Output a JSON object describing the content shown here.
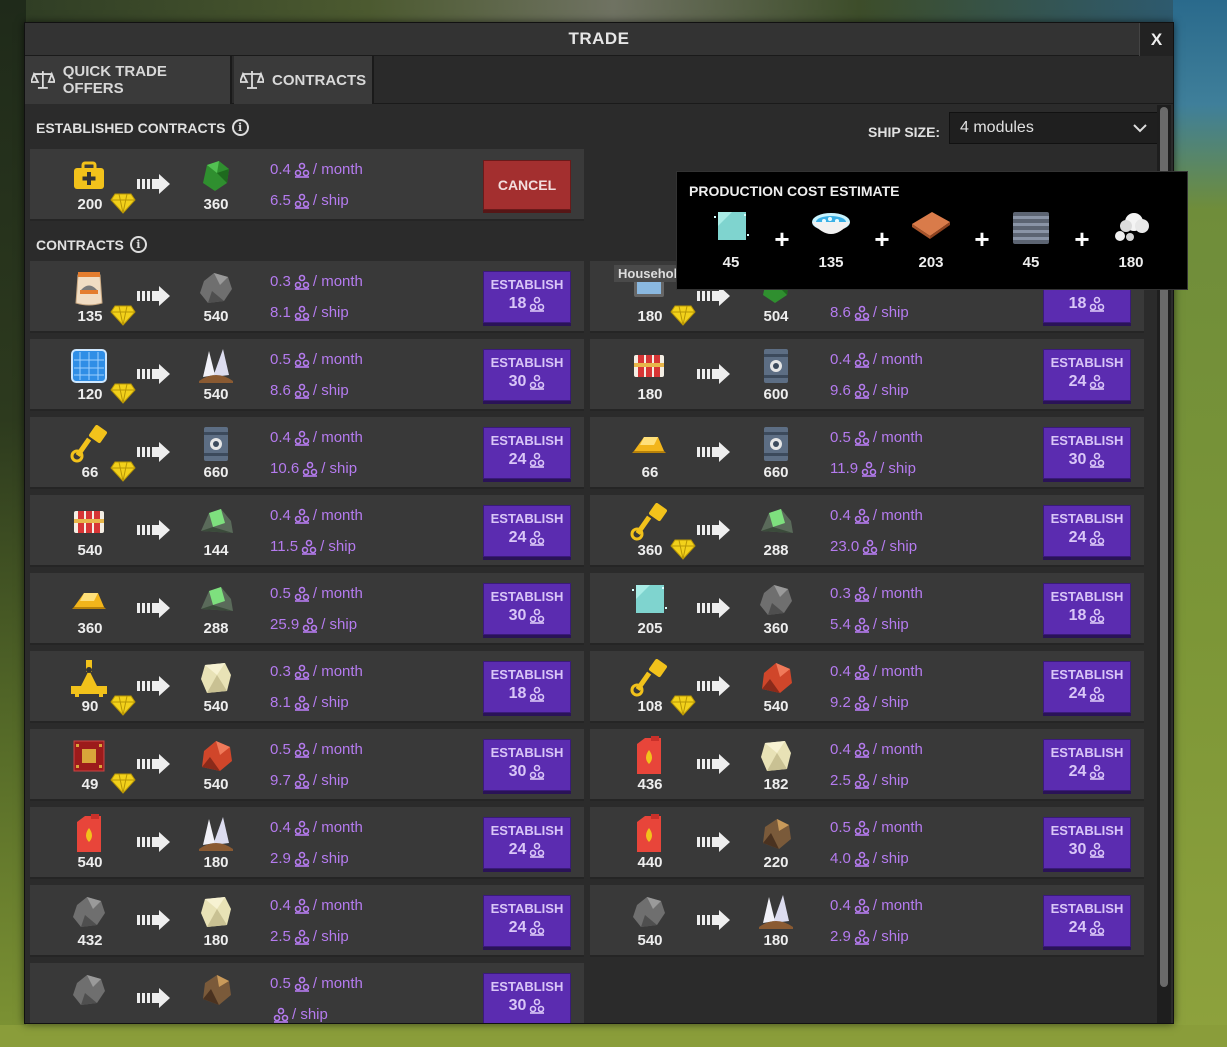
{
  "window": {
    "title": "TRADE",
    "close_label": "X"
  },
  "tabs": [
    {
      "label": "QUICK TRADE OFFERS",
      "icon": "scale-icon"
    },
    {
      "label": "CONTRACTS",
      "icon": "scale-icon"
    }
  ],
  "established": {
    "title": "ESTABLISHED CONTRACTS",
    "card": {
      "in_icon": "medkit-icon",
      "in_qty": "200",
      "out_icon": "green-ore-icon",
      "out_qty": "360",
      "month": "0.4",
      "ship": "6.5",
      "action": "CANCEL"
    }
  },
  "ship_size": {
    "label": "SHIP SIZE:",
    "value": "4 modules"
  },
  "contracts_title": "CONTRACTS",
  "units": {
    "month": "/ month",
    "ship": "/ ship"
  },
  "establish_label": "ESTABLISH",
  "contracts_left": [
    {
      "in_icon": "food-sack-icon",
      "in_qty": "135",
      "gem": true,
      "out_icon": "rock-icon",
      "out_qty": "540",
      "month": "0.3",
      "ship": "8.1",
      "cost": "18"
    },
    {
      "in_icon": "solar-panel-icon",
      "in_qty": "120",
      "gem": true,
      "out_icon": "quartz-icon",
      "out_qty": "540",
      "month": "0.5",
      "ship": "8.6",
      "cost": "30"
    },
    {
      "in_icon": "piston-icon",
      "in_qty": "66",
      "gem": true,
      "out_icon": "barrel-icon",
      "out_qty": "660",
      "month": "0.4",
      "ship": "10.6",
      "cost": "24"
    },
    {
      "in_icon": "dynamite-icon",
      "in_qty": "540",
      "gem": false,
      "out_icon": "green-rock-icon",
      "out_qty": "144",
      "month": "0.4",
      "ship": "11.5",
      "cost": "24"
    },
    {
      "in_icon": "gold-bar-icon",
      "in_qty": "360",
      "gem": false,
      "out_icon": "green-rock-icon",
      "out_qty": "288",
      "month": "0.5",
      "ship": "25.9",
      "cost": "30"
    },
    {
      "in_icon": "crane-icon",
      "in_qty": "90",
      "gem": true,
      "out_icon": "sandstone-icon",
      "out_qty": "540",
      "month": "0.3",
      "ship": "8.1",
      "cost": "18"
    },
    {
      "in_icon": "chip-icon",
      "in_qty": "49",
      "gem": true,
      "out_icon": "red-ore-icon",
      "out_qty": "540",
      "month": "0.5",
      "ship": "9.7",
      "cost": "30"
    },
    {
      "in_icon": "fuel-can-icon",
      "in_qty": "540",
      "gem": false,
      "out_icon": "quartz-icon",
      "out_qty": "180",
      "month": "0.4",
      "ship": "2.9",
      "cost": "24"
    },
    {
      "in_icon": "rock-icon",
      "in_qty": "432",
      "gem": false,
      "out_icon": "sandstone-icon",
      "out_qty": "180",
      "month": "0.4",
      "ship": "2.5",
      "cost": "24"
    },
    {
      "in_icon": "rock-icon",
      "in_qty": "",
      "gem": false,
      "out_icon": "brown-ore-icon",
      "out_qty": "",
      "month": "0.5",
      "ship": "",
      "cost": "30"
    }
  ],
  "contracts_right": [
    {
      "in_icon": "household-electronics-icon",
      "in_label": "Household electronics",
      "in_qty": "180",
      "gem": true,
      "out_icon": "green-ore-icon",
      "out_qty": "504",
      "month": "",
      "ship": "8.6",
      "cost": "18"
    },
    {
      "in_icon": "dynamite-icon",
      "in_qty": "180",
      "gem": false,
      "out_icon": "barrel-icon",
      "out_qty": "600",
      "month": "0.4",
      "ship": "9.6",
      "cost": "24"
    },
    {
      "in_icon": "gold-bar-icon",
      "in_qty": "66",
      "gem": false,
      "out_icon": "barrel-icon",
      "out_qty": "660",
      "month": "0.5",
      "ship": "11.9",
      "cost": "30"
    },
    {
      "in_icon": "piston-icon",
      "in_qty": "360",
      "gem": true,
      "out_icon": "green-rock-icon",
      "out_qty": "288",
      "month": "0.4",
      "ship": "23.0",
      "cost": "24"
    },
    {
      "in_icon": "glass-icon",
      "in_qty": "205",
      "gem": false,
      "out_icon": "rock-icon",
      "out_qty": "360",
      "month": "0.3",
      "ship": "5.4",
      "cost": "18"
    },
    {
      "in_icon": "piston-icon",
      "in_qty": "108",
      "gem": true,
      "out_icon": "red-ore-icon",
      "out_qty": "540",
      "month": "0.4",
      "ship": "9.2",
      "cost": "24"
    },
    {
      "in_icon": "fuel-can-icon",
      "in_qty": "436",
      "gem": false,
      "out_icon": "sandstone-icon",
      "out_qty": "182",
      "month": "0.4",
      "ship": "2.5",
      "cost": "24"
    },
    {
      "in_icon": "fuel-can-icon",
      "in_qty": "440",
      "gem": false,
      "out_icon": "brown-ore-icon",
      "out_qty": "220",
      "month": "0.5",
      "ship": "4.0",
      "cost": "30"
    },
    {
      "in_icon": "rock-icon",
      "in_qty": "540",
      "gem": false,
      "out_icon": "quartz-icon",
      "out_qty": "180",
      "month": "0.4",
      "ship": "2.9",
      "cost": "24"
    }
  ],
  "tooltip": {
    "title": "PRODUCTION COST ESTIMATE",
    "items": [
      {
        "icon": "glass-icon",
        "qty": "45"
      },
      {
        "icon": "bowl-icon",
        "qty": "135"
      },
      {
        "icon": "wood-plank-icon",
        "qty": "203"
      },
      {
        "icon": "steel-icon",
        "qty": "45"
      },
      {
        "icon": "cotton-icon",
        "qty": "180"
      }
    ],
    "plus": "+"
  },
  "colors": {
    "accent_purple": "#5b2cb0",
    "rate_purple": "#b57bef",
    "cancel_red": "#a32f2f",
    "gem_yellow": "#f2d11b"
  }
}
